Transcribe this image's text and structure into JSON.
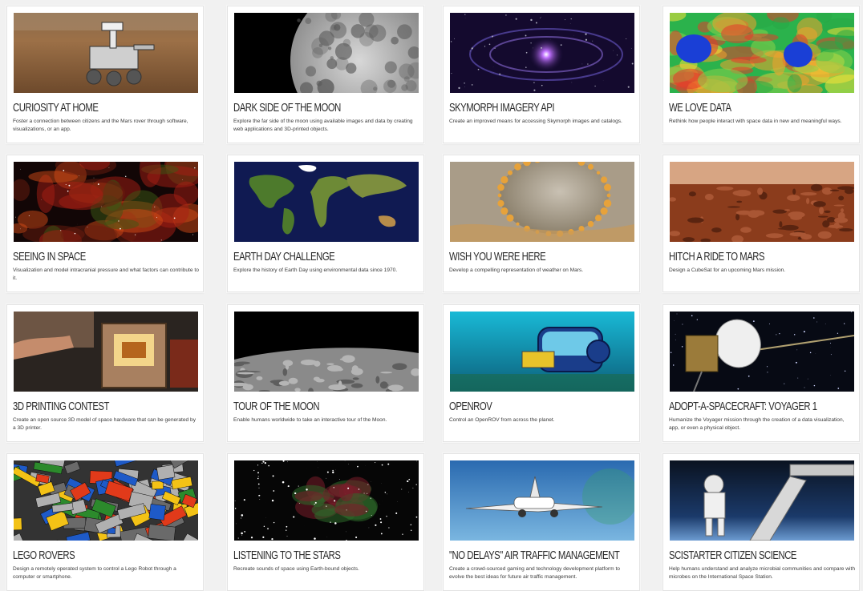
{
  "challenges": [
    {
      "title": "CURIOSITY AT HOME",
      "description": "Foster a connection between citizens and the Mars rover through software, visualizations, or an app.",
      "image": "mars-rover-image"
    },
    {
      "title": "DARK SIDE OF THE MOON",
      "description": "Explore the far side of the moon using available images and data by creating web applications and 3D-printed objects.",
      "image": "moon-image"
    },
    {
      "title": "SKYMORPH IMAGERY API",
      "description": "Create an improved means for accessing Skymorph images and catalogs.",
      "image": "galaxy-image"
    },
    {
      "title": "WE LOVE DATA",
      "description": "Rethink how people interact with space data in new and meaningful ways.",
      "image": "heatmap-image"
    },
    {
      "title": "SEEING IN SPACE",
      "description": "Visualization and model intracranial pressure and what factors can contribute to it.",
      "image": "nebula-image"
    },
    {
      "title": "EARTH DAY CHALLENGE",
      "description": "Explore the history of Earth Day using environmental data since 1970.",
      "image": "world-map-image"
    },
    {
      "title": "WISH YOU WERE HERE",
      "description": "Develop a compelling representation of weather on Mars.",
      "image": "crater-image"
    },
    {
      "title": "HITCH A RIDE TO MARS",
      "description": "Design a CubeSat for an upcoming Mars mission.",
      "image": "mars-surface-image"
    },
    {
      "title": "3D PRINTING CONTEST",
      "description": "Create an open source 3D model of space hardware that can be generated by a 3D printer.",
      "image": "3d-printer-image"
    },
    {
      "title": "TOUR OF THE MOON",
      "description": "Enable humans worldwide to take an interactive tour of the Moon.",
      "image": "lunar-surface-image"
    },
    {
      "title": "OPENROV",
      "description": "Control an OpenROV from across the planet.",
      "image": "underwater-rov-image"
    },
    {
      "title": "ADOPT-A-SPACECRAFT: VOYAGER 1",
      "description": "Humanize the Voyager mission through the creation of a data visualization, app, or even a physical object.",
      "image": "voyager-image"
    },
    {
      "title": "LEGO ROVERS",
      "description": "Design a remotely operated system to control a Lego Robot through a computer or smartphone.",
      "image": "lego-image"
    },
    {
      "title": "LISTENING TO THE STARS",
      "description": "Recreate sounds of space using Earth-bound objects.",
      "image": "star-field-image"
    },
    {
      "title": "\"NO DELAYS\" AIR TRAFFIC MANAGEMENT",
      "description": "Create a crowd-sourced gaming and technology development platform to evolve the best ideas for future air traffic management.",
      "image": "airplane-image"
    },
    {
      "title": "SCISTARTER CITIZEN SCIENCE",
      "description": "Help humans understand and analyze microbial communities and compare with microbes on the International Space Station.",
      "image": "astronaut-image"
    }
  ]
}
